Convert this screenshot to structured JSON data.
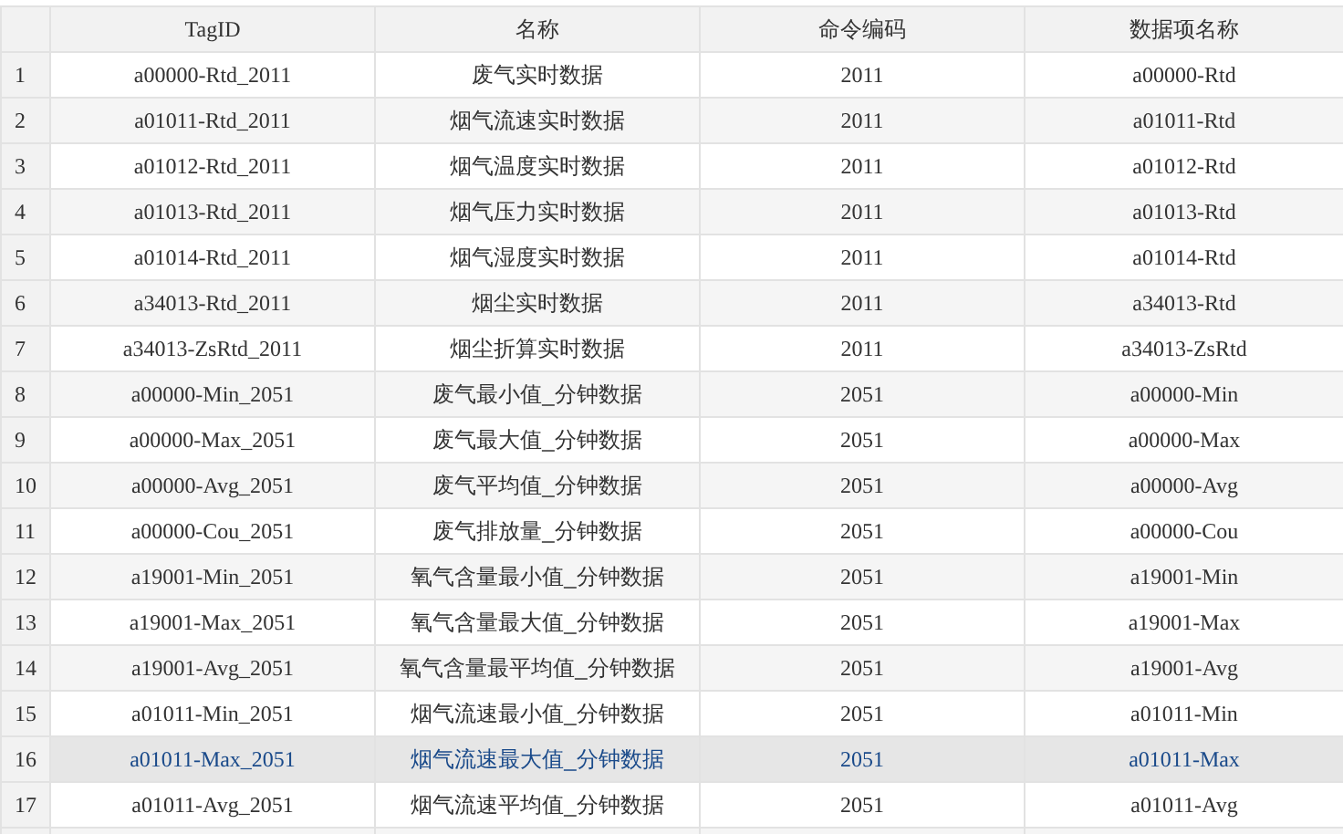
{
  "table": {
    "columns": [
      "TagID",
      "名称",
      "命令编码",
      "数据项名称"
    ],
    "rows": [
      {
        "row_number": "1",
        "tag_id": "a00000-Rtd_2011",
        "name": "废气实时数据",
        "command_code": "2011",
        "data_item_name": "a00000-Rtd",
        "selected": false
      },
      {
        "row_number": "2",
        "tag_id": "a01011-Rtd_2011",
        "name": "烟气流速实时数据",
        "command_code": "2011",
        "data_item_name": "a01011-Rtd",
        "selected": false
      },
      {
        "row_number": "3",
        "tag_id": "a01012-Rtd_2011",
        "name": "烟气温度实时数据",
        "command_code": "2011",
        "data_item_name": "a01012-Rtd",
        "selected": false
      },
      {
        "row_number": "4",
        "tag_id": "a01013-Rtd_2011",
        "name": "烟气压力实时数据",
        "command_code": "2011",
        "data_item_name": "a01013-Rtd",
        "selected": false
      },
      {
        "row_number": "5",
        "tag_id": "a01014-Rtd_2011",
        "name": "烟气湿度实时数据",
        "command_code": "2011",
        "data_item_name": "a01014-Rtd",
        "selected": false
      },
      {
        "row_number": "6",
        "tag_id": "a34013-Rtd_2011",
        "name": "烟尘实时数据",
        "command_code": "2011",
        "data_item_name": "a34013-Rtd",
        "selected": false
      },
      {
        "row_number": "7",
        "tag_id": "a34013-ZsRtd_2011",
        "name": "烟尘折算实时数据",
        "command_code": "2011",
        "data_item_name": "a34013-ZsRtd",
        "selected": false
      },
      {
        "row_number": "8",
        "tag_id": "a00000-Min_2051",
        "name": "废气最小值_分钟数据",
        "command_code": "2051",
        "data_item_name": "a00000-Min",
        "selected": false
      },
      {
        "row_number": "9",
        "tag_id": "a00000-Max_2051",
        "name": "废气最大值_分钟数据",
        "command_code": "2051",
        "data_item_name": "a00000-Max",
        "selected": false
      },
      {
        "row_number": "10",
        "tag_id": "a00000-Avg_2051",
        "name": "废气平均值_分钟数据",
        "command_code": "2051",
        "data_item_name": "a00000-Avg",
        "selected": false
      },
      {
        "row_number": "11",
        "tag_id": "a00000-Cou_2051",
        "name": "废气排放量_分钟数据",
        "command_code": "2051",
        "data_item_name": "a00000-Cou",
        "selected": false
      },
      {
        "row_number": "12",
        "tag_id": "a19001-Min_2051",
        "name": "氧气含量最小值_分钟数据",
        "command_code": "2051",
        "data_item_name": "a19001-Min",
        "selected": false
      },
      {
        "row_number": "13",
        "tag_id": "a19001-Max_2051",
        "name": "氧气含量最大值_分钟数据",
        "command_code": "2051",
        "data_item_name": "a19001-Max",
        "selected": false
      },
      {
        "row_number": "14",
        "tag_id": "a19001-Avg_2051",
        "name": "氧气含量最平均值_分钟数据",
        "command_code": "2051",
        "data_item_name": "a19001-Avg",
        "selected": false
      },
      {
        "row_number": "15",
        "tag_id": "a01011-Min_2051",
        "name": "烟气流速最小值_分钟数据",
        "command_code": "2051",
        "data_item_name": "a01011-Min",
        "selected": false
      },
      {
        "row_number": "16",
        "tag_id": "a01011-Max_2051",
        "name": "烟气流速最大值_分钟数据",
        "command_code": "2051",
        "data_item_name": "a01011-Max",
        "selected": true
      },
      {
        "row_number": "17",
        "tag_id": "a01011-Avg_2051",
        "name": "烟气流速平均值_分钟数据",
        "command_code": "2051",
        "data_item_name": "a01011-Avg",
        "selected": false
      }
    ]
  }
}
